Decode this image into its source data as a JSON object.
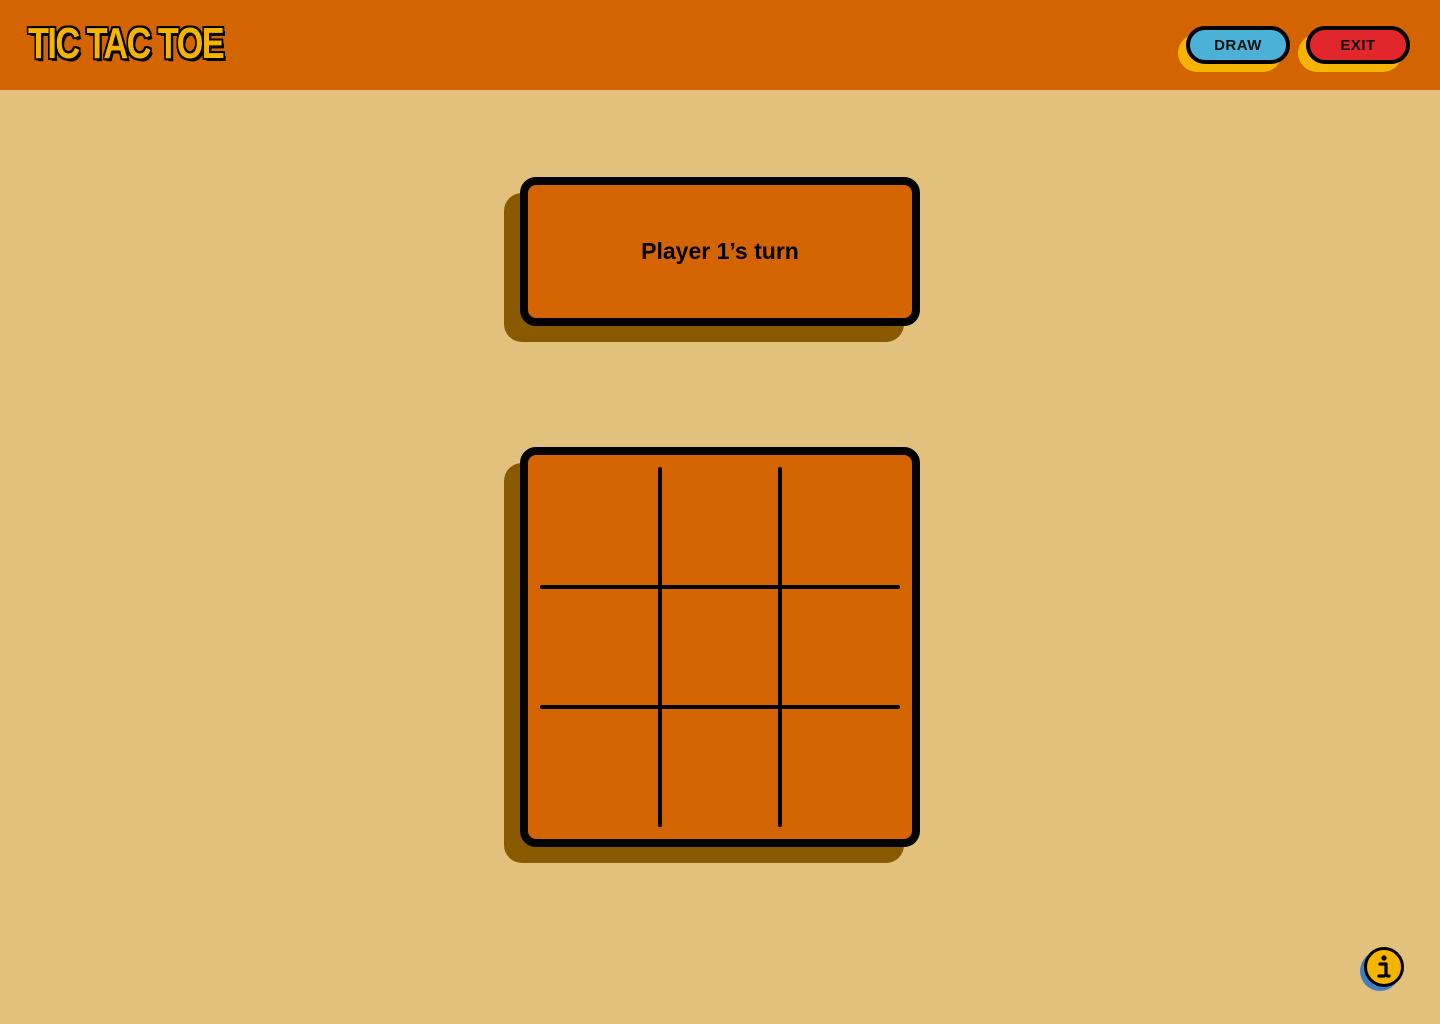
{
  "app": {
    "title": "TIC TAC TOE"
  },
  "header": {
    "draw_label": "DRAW",
    "exit_label": "EXIT"
  },
  "status": {
    "turn_text": "Player 1’s turn"
  },
  "board": {
    "rows": 3,
    "cols": 3,
    "cells": [
      "",
      "",
      "",
      "",
      "",
      "",
      "",
      "",
      ""
    ]
  },
  "icons": {
    "info": "info-icon"
  },
  "colors": {
    "background": "#E2C17D",
    "header": "#D36400",
    "card": "#D36400",
    "card_shadow": "#8A5A00",
    "draw_button": "#4BB1D6",
    "exit_button": "#E1262C",
    "accent_yellow": "#F5B400",
    "info_shadow": "#3F7FC0"
  }
}
